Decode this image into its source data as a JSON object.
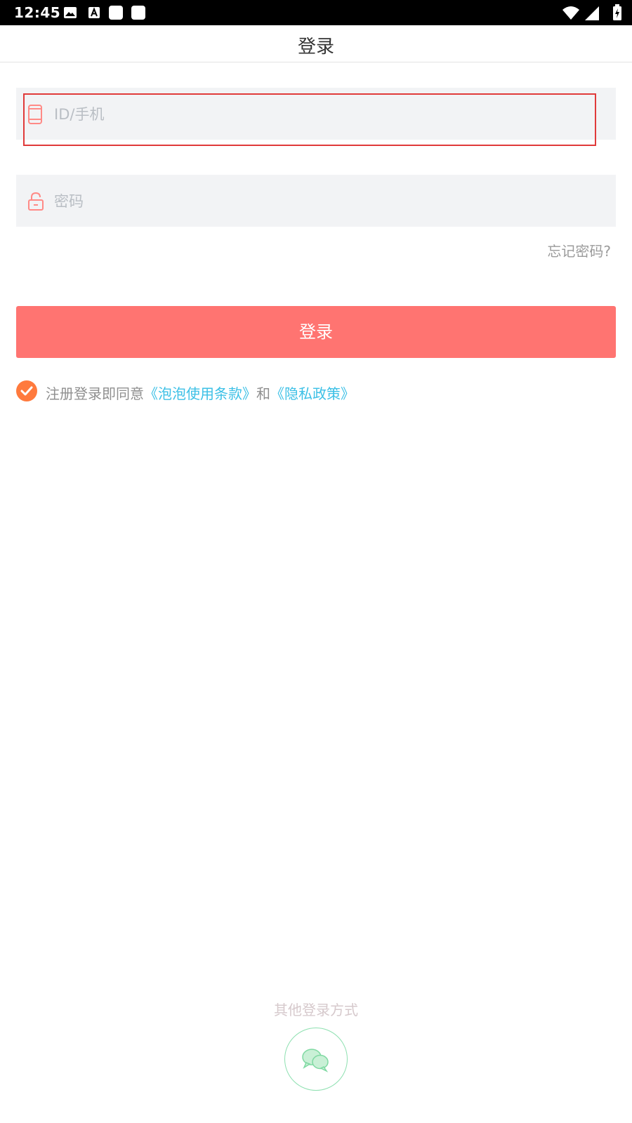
{
  "status_bar": {
    "time": "12:45",
    "icons_left": [
      "image-icon",
      "a-icon",
      "notification-square-icon",
      "notification-square-icon"
    ],
    "icons_right": [
      "wifi-icon",
      "cell-signal-icon",
      "battery-icon"
    ]
  },
  "header": {
    "title": "登录"
  },
  "form": {
    "id_placeholder": "ID/手机",
    "password_placeholder": "密码",
    "forgot_password": "忘记密码?",
    "login_button": "登录"
  },
  "agreement": {
    "prefix": "注册登录即同意",
    "terms_link": "《泡泡使用条款》",
    "conjunction": "和",
    "privacy_link": "《隐私政策》",
    "checked": true
  },
  "other_login": {
    "label": "其他登录方式",
    "wechat_icon": "wechat-icon"
  },
  "colors": {
    "accent": "#ff7471",
    "checkbox": "#ff7a3d",
    "link": "#3cc0e6",
    "wechat": "#6fd59b",
    "highlight_box": "#e03a3a"
  }
}
